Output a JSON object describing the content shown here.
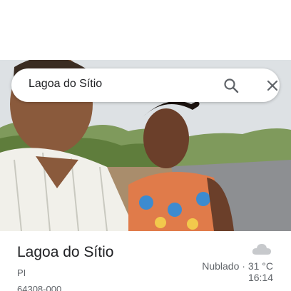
{
  "search": {
    "query": "Lagoa do Sítio",
    "search_icon": "search-icon",
    "close_icon": "close-icon"
  },
  "photo": {
    "description_icon": "photo"
  },
  "place": {
    "title": "Lagoa do Sítio",
    "region": "PI",
    "postal_code": "64308-000"
  },
  "weather": {
    "icon": "cloud-icon",
    "condition": "Nublado",
    "separator": "·",
    "temperature": "31 °C",
    "time": "16:14"
  },
  "colors": {
    "text_primary": "#202124",
    "text_secondary": "#5f6368",
    "icon": "#5f6368"
  }
}
